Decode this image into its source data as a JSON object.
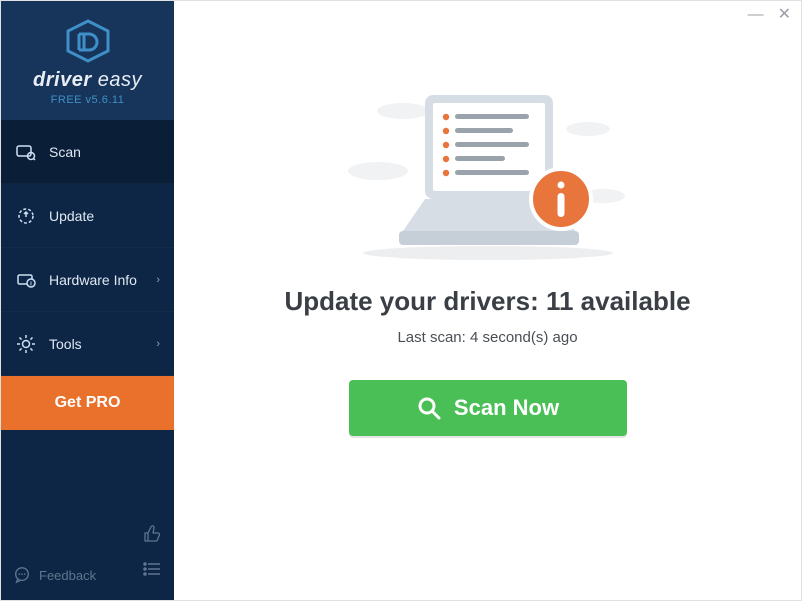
{
  "window": {
    "minimize": "—",
    "close": "✕"
  },
  "brand": {
    "name_strong": "driver",
    "name_light": " easy",
    "version": "FREE v5.6.11"
  },
  "sidebar": {
    "items": [
      {
        "label": "Scan"
      },
      {
        "label": "Update"
      },
      {
        "label": "Hardware Info"
      },
      {
        "label": "Tools"
      }
    ],
    "get_pro": "Get PRO",
    "feedback": "Feedback"
  },
  "main": {
    "headline": "Update your drivers: 11 available",
    "subline": "Last scan: 4 second(s) ago",
    "scan_button": "Scan Now"
  },
  "colors": {
    "sidebar_bg": "#0d2645",
    "sidebar_header": "#17355b",
    "accent_orange": "#e9712b",
    "accent_green": "#4abf56",
    "info_orange": "#e8763c"
  }
}
